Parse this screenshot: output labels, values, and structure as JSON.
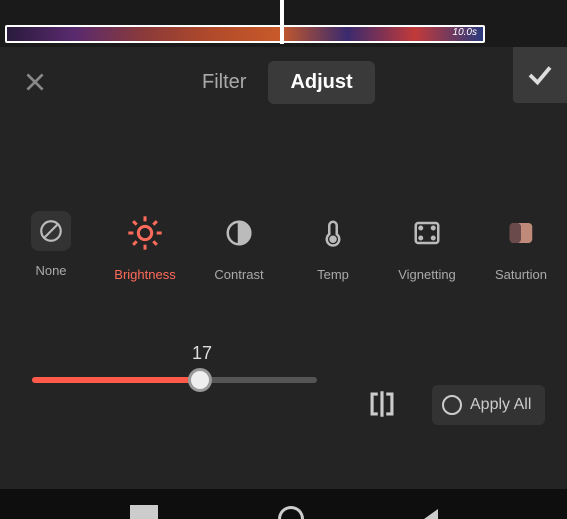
{
  "timeline": {
    "duration_label": "10.0s"
  },
  "tabs": {
    "filter": "Filter",
    "adjust": "Adjust",
    "active": "adjust"
  },
  "options": {
    "none": "None",
    "brightness": "Brightness",
    "contrast": "Contrast",
    "temp": "Temp",
    "vignetting": "Vignetting",
    "saturation": "Saturtion",
    "selected": "brightness"
  },
  "slider": {
    "value": 17,
    "min": 0,
    "max": 50
  },
  "actions": {
    "apply_all": "Apply All"
  },
  "colors": {
    "accent": "#ff5a4a",
    "panel": "#242424"
  }
}
